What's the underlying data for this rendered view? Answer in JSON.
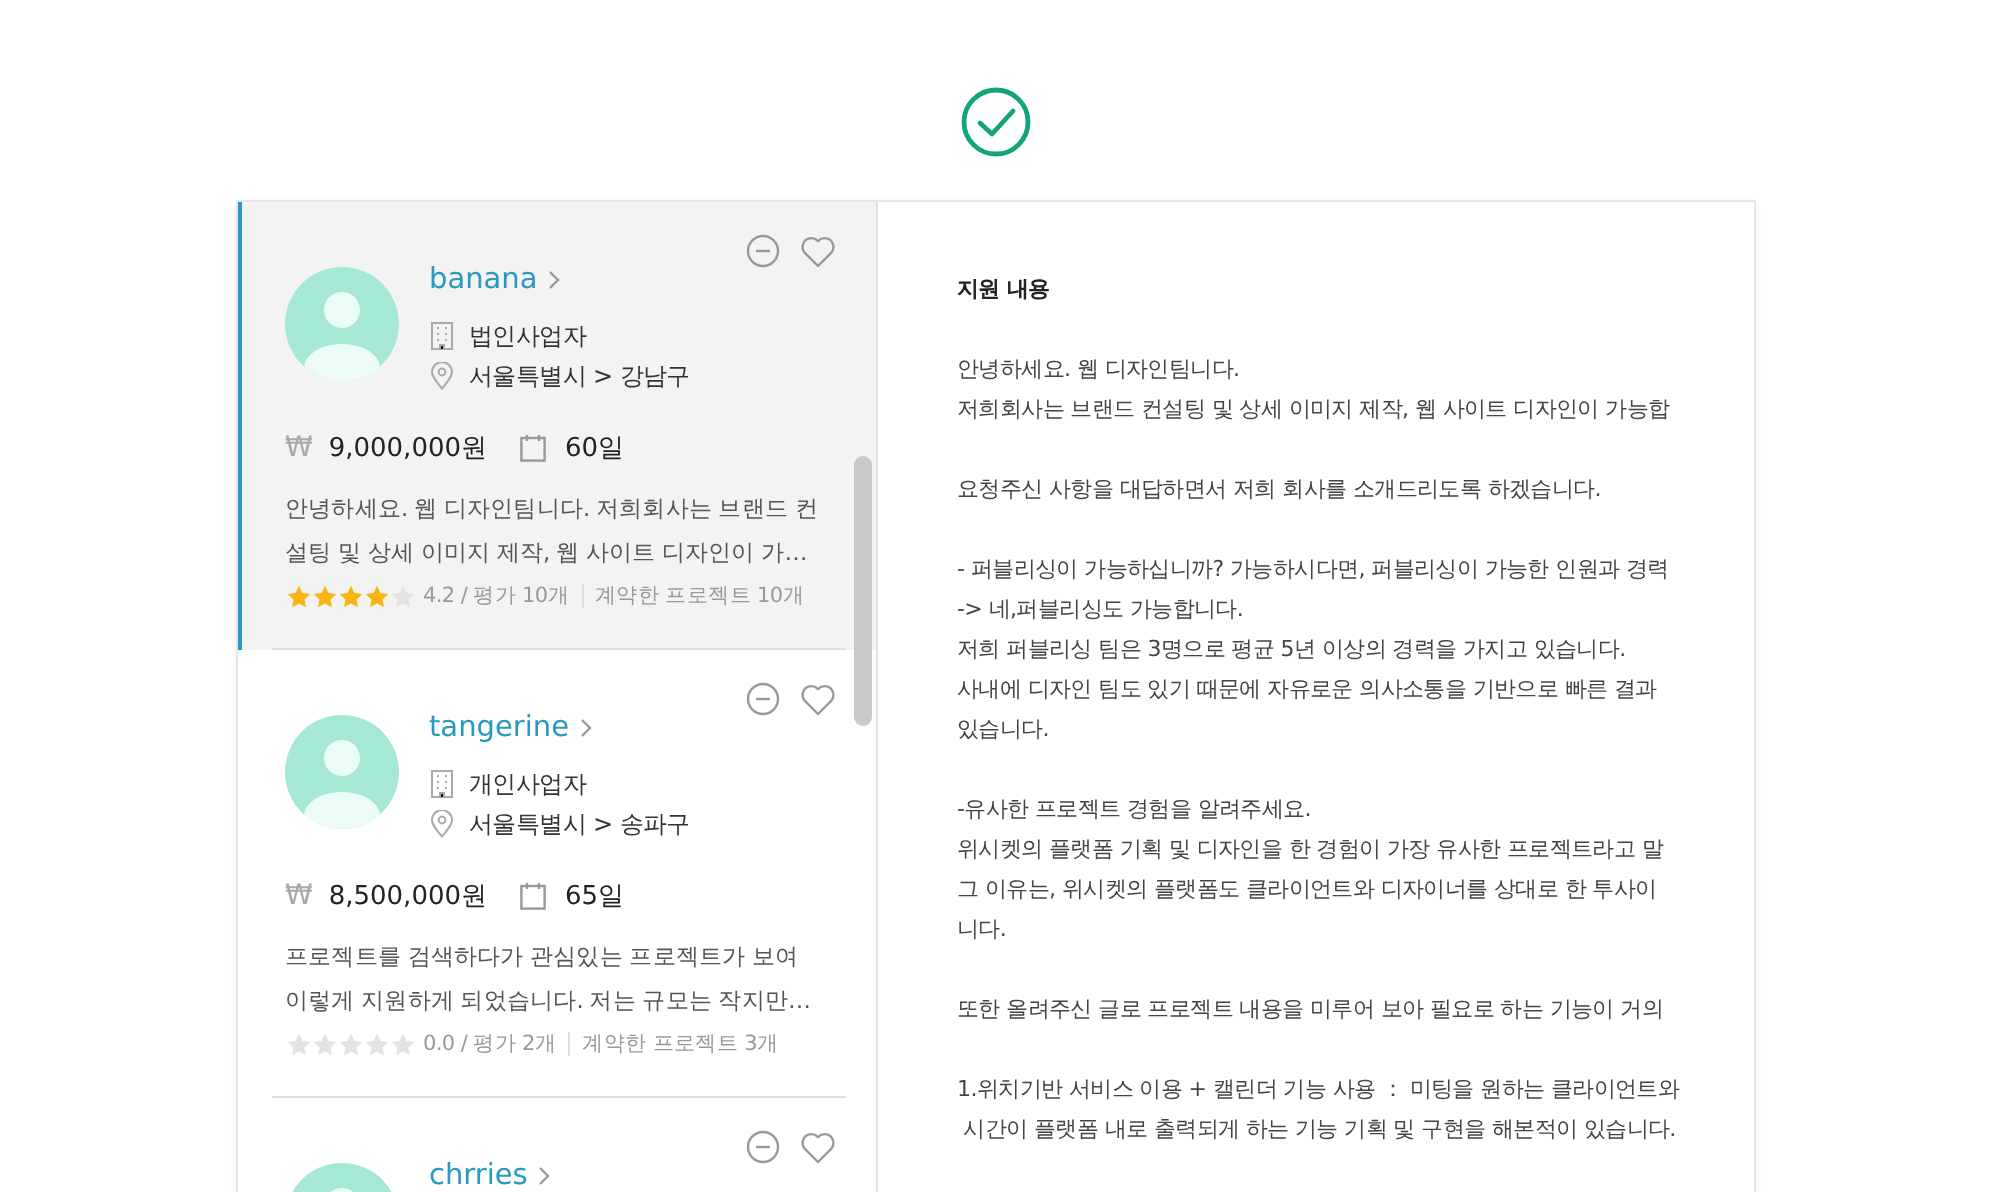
{
  "applicants": [
    {
      "name": "banana",
      "selected": true,
      "business_type": "법인사업자",
      "location": "서울특별시 > 강남구",
      "currency": "₩",
      "price": "9,000,000원",
      "duration": "60일",
      "description": "안녕하세요. 웹 디자인팀니다. 저희회사는 브랜드 컨설팅 및 상세 이미지 제작, 웹 사이트 디자인이 가…",
      "stars": 4,
      "rating": "4.2 / 평가 10개",
      "contracts": "계약한 프로젝트 10개"
    },
    {
      "name": "tangerine",
      "selected": false,
      "business_type": "개인사업자",
      "location": "서울특별시 > 송파구",
      "currency": "₩",
      "price": "8,500,000원",
      "duration": "65일",
      "description": "프로젝트를 검색하다가 관심있는 프로젝트가 보여 이렇게 지원하게 되었습니다. 저는 규모는 작지만…",
      "stars": 0,
      "rating": "0.0 / 평가 2개",
      "contracts": "계약한 프로젝트 3개"
    },
    {
      "name": "chrries",
      "selected": false
    }
  ],
  "detail": {
    "title": "지원 내용",
    "paragraphs": [
      [
        "안녕하세요. 웹 디자인팀니다.",
        "저희회사는 브랜드 컨설팅 및 상세 이미지 제작, 웹 사이트 디자인이 가능합"
      ],
      [
        "요청주신 사항을 대답하면서 저희 회사를 소개드리도록 하겠습니다."
      ],
      [
        "- 퍼블리싱이 가능하십니까? 가능하시다면, 퍼블리싱이 가능한 인원과 경력",
        "-> 네,퍼블리싱도 가능합니다.",
        "저희 퍼블리싱 팀은 3명으로 평균 5년 이상의 경력을 가지고 있습니다.",
        "사내에 디자인 팀도 있기 때문에 자유로운 의사소통을 기반으로 빠른 결과",
        "있습니다."
      ],
      [
        "-유사한 프로젝트 경험을 알려주세요.",
        "위시켓의 플랫폼 기획 및 디자인을 한 경험이 가장 유사한 프로젝트라고 말",
        "그 이유는, 위시켓의 플랫폼도 클라이언트와 디자이너를 상대로 한 투사이",
        "니다."
      ],
      [
        "또한 올려주신 글로 프로젝트 내용을 미루어 보아 필요로 하는 기능이 거의"
      ],
      [
        "1.위치기반 서비스 이용 + 캘린더 기능 사용 ： 미팅을 원하는 클라이언트와",
        " 시간이 플랫폼 내로 출력되게 하는 기능 기획 및 구현을 해본적이 있습니다."
      ]
    ]
  }
}
